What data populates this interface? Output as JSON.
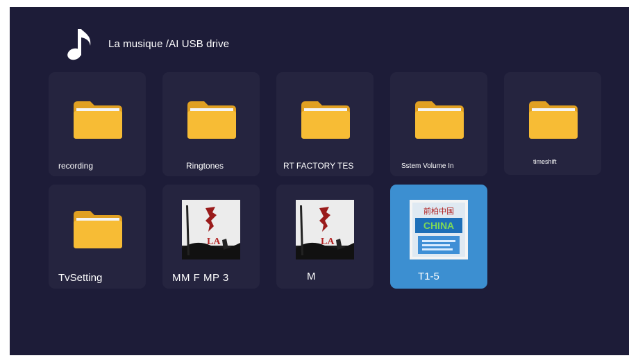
{
  "header": {
    "title": "La musique /AI USB drive",
    "icon": "music-note-icon"
  },
  "items": [
    {
      "label": "recording",
      "type": "folder"
    },
    {
      "label": "Ringtones",
      "type": "folder"
    },
    {
      "label": "RT FACTORY TES",
      "type": "folder"
    },
    {
      "label": "Sstem Volume In",
      "type": "folder"
    },
    {
      "label": "timeshift",
      "type": "folder"
    },
    {
      "label": "TvSetting",
      "type": "folder"
    },
    {
      "label": "MM F MP 3",
      "type": "audio",
      "cover_title": "LA"
    },
    {
      "label": "M",
      "type": "audio",
      "cover_title": "LA"
    },
    {
      "label": "T1-5",
      "type": "audio",
      "cover_title": "前柏中国",
      "cover_banner": "CHINA",
      "selected": true
    }
  ],
  "colors": {
    "background": "#1d1c38",
    "tile": "#25243f",
    "selected_tile": "#3c8fd1",
    "folder": "#f5b731"
  }
}
